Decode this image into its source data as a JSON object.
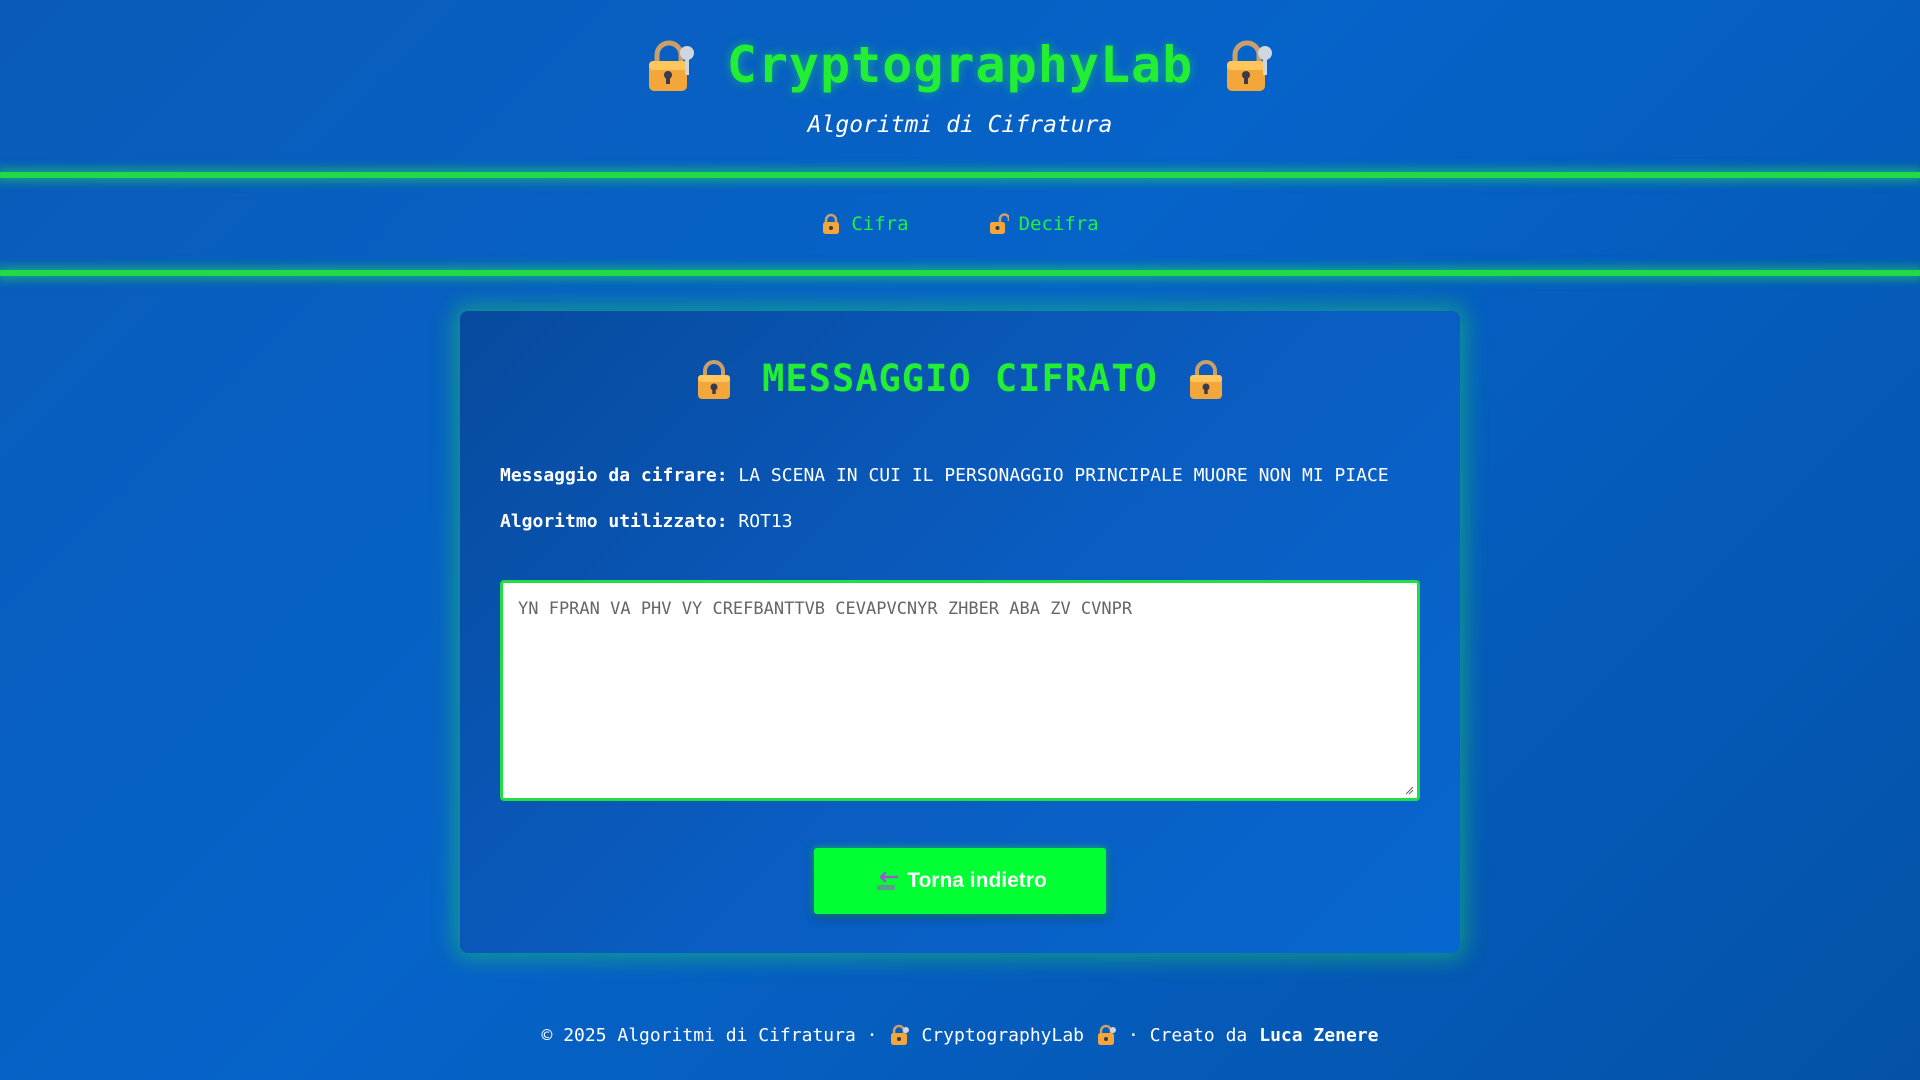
{
  "header": {
    "title": "CryptographyLab",
    "subtitle": "Algoritmi di Cifratura",
    "icon": "lock-with-key-icon"
  },
  "nav": {
    "items": [
      {
        "label": "Cifra",
        "icon": "locked-icon"
      },
      {
        "label": "Decifra",
        "icon": "unlocked-icon"
      }
    ]
  },
  "card": {
    "title": "MESSAGGIO CIFRATO",
    "message_label": "Messaggio da cifrare:",
    "message_value": "LA SCENA IN CUI IL PERSONAGGIO PRINCIPALE MUORE NON MI PIACE",
    "algorithm_label": "Algoritmo utilizzato:",
    "algorithm_value": "ROT13",
    "result_text": "YN FPRAN VA PHV VY CREFBANTTVB CEVAPVCNYR ZHBER ABA ZV CVNPR",
    "back_button_label": "Torna indietro",
    "back_button_icon": "back-arrow-icon"
  },
  "footer": {
    "prefix": "© 2025 Algoritmi di Cifratura ·",
    "brand": "CryptographyLab",
    "created_prefix": "· Creato da",
    "author": "Luca Zenere"
  },
  "colors": {
    "accent_green": "#22ee33",
    "button_green": "#00ff33",
    "background_blue": "#0663c9"
  }
}
